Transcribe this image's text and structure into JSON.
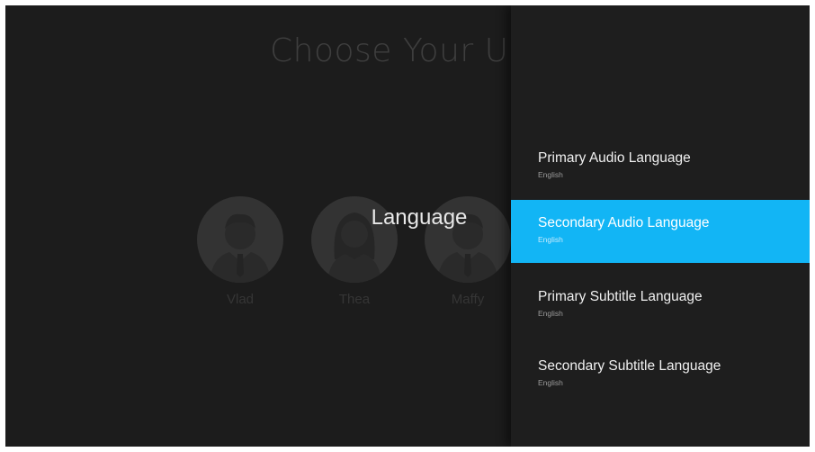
{
  "background": {
    "title": "Choose Your U",
    "users": [
      {
        "name": "Vlad",
        "avatar_icon": "male-avatar-icon"
      },
      {
        "name": "Thea",
        "avatar_icon": "female-avatar-icon"
      },
      {
        "name": "Maffy",
        "avatar_icon": "male-avatar-icon"
      }
    ]
  },
  "side_header": "Language",
  "menu": {
    "items": [
      {
        "title": "Primary Audio Language",
        "value": "English"
      },
      {
        "title": "Secondary Audio Language",
        "value": "English",
        "selected": true
      },
      {
        "title": "Primary Subtitle Language",
        "value": "English"
      },
      {
        "title": "Secondary Subtitle Language",
        "value": "English"
      }
    ]
  },
  "colors": {
    "background": "#1c1c1c",
    "panel": "#1e1e1e",
    "selection": "#12b5f5"
  }
}
